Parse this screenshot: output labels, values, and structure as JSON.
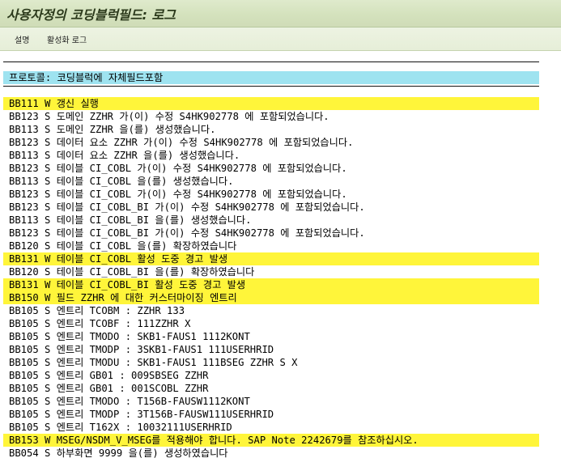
{
  "window": {
    "title": "사용자정의 코딩블럭필드: 로그"
  },
  "toolbar": {
    "description_label": "설명",
    "activation_log_label": "활성화 로그"
  },
  "log": {
    "header": "프로토콜: 코딩블럭에 자체필드포함",
    "highlight_color": "#fff53a",
    "header_color": "#9ee3f0",
    "lines": [
      {
        "text": "BB111 W 갱신 실행",
        "highlight": true
      },
      {
        "text": "BB123 S 도메인 ZZHR 가(이) 수정 S4HK902778 에 포함되었습니다.",
        "highlight": false
      },
      {
        "text": "BB113 S 도메인 ZZHR 을(를) 생성했습니다.",
        "highlight": false
      },
      {
        "text": "BB123 S 데이터 요소 ZZHR 가(이) 수정 S4HK902778 에 포함되었습니다.",
        "highlight": false
      },
      {
        "text": "BB113 S 데이터 요소 ZZHR 을(를) 생성했습니다.",
        "highlight": false
      },
      {
        "text": "BB123 S 테이블 CI_COBL 가(이) 수정 S4HK902778 에 포함되었습니다.",
        "highlight": false
      },
      {
        "text": "BB113 S 테이블 CI_COBL 을(를) 생성했습니다.",
        "highlight": false
      },
      {
        "text": "BB123 S 테이블 CI_COBL 가(이) 수정 S4HK902778 에 포함되었습니다.",
        "highlight": false
      },
      {
        "text": "BB123 S 테이블 CI_COBL_BI 가(이) 수정 S4HK902778 에 포함되었습니다.",
        "highlight": false
      },
      {
        "text": "BB113 S 테이블 CI_COBL_BI 을(를) 생성했습니다.",
        "highlight": false
      },
      {
        "text": "BB123 S 테이블 CI_COBL_BI 가(이) 수정 S4HK902778 에 포함되었습니다.",
        "highlight": false
      },
      {
        "text": "BB120 S 테이블 CI_COBL 을(를) 확장하였습니다",
        "highlight": false
      },
      {
        "text": "BB131 W 테이블 CI_COBL 활성 도중 경고 발생",
        "highlight": true
      },
      {
        "text": "BB120 S 테이블 CI_COBL_BI 을(를) 확장하였습니다",
        "highlight": false
      },
      {
        "text": "BB131 W 테이블 CI_COBL_BI 활성 도중 경고 발생",
        "highlight": true
      },
      {
        "text": "BB150 W 필드 ZZHR 에 대한 커스터마이징 엔트리",
        "highlight": true
      },
      {
        "text": "BB105 S 엔트리 TCOBM : ZZHR 133",
        "highlight": false
      },
      {
        "text": "BB105 S 엔트리 TCOBF : 111ZZHR X",
        "highlight": false
      },
      {
        "text": "BB105 S 엔트리 TMODO : SKB1-FAUS1 1112KONT",
        "highlight": false
      },
      {
        "text": "BB105 S 엔트리 TMODP : 3SKB1-FAUS1 111USERHRID",
        "highlight": false
      },
      {
        "text": "BB105 S 엔트리 TMODU : SKB1-FAUS1 111BSEG ZZHR S X",
        "highlight": false
      },
      {
        "text": "BB105 S 엔트리 GB01 : 009SBSEG ZZHR",
        "highlight": false
      },
      {
        "text": "BB105 S 엔트리 GB01 : 001SCOBL ZZHR",
        "highlight": false
      },
      {
        "text": "BB105 S 엔트리 TMODO : T156B-FAUSW1112KONT",
        "highlight": false
      },
      {
        "text": "BB105 S 엔트리 TMODP : 3T156B-FAUSW111USERHRID",
        "highlight": false
      },
      {
        "text": "BB105 S 엔트리 T162X : 10032111USERHRID",
        "highlight": false
      },
      {
        "text": "BB153 W MSEG/NSDM_V_MSEG를 적용해야 합니다. SAP Note 2242679를 참조하십시오.",
        "highlight": true
      },
      {
        "text": "BB054 S 하부화면 9999 을(를) 생성하였습니다",
        "highlight": false
      }
    ]
  }
}
